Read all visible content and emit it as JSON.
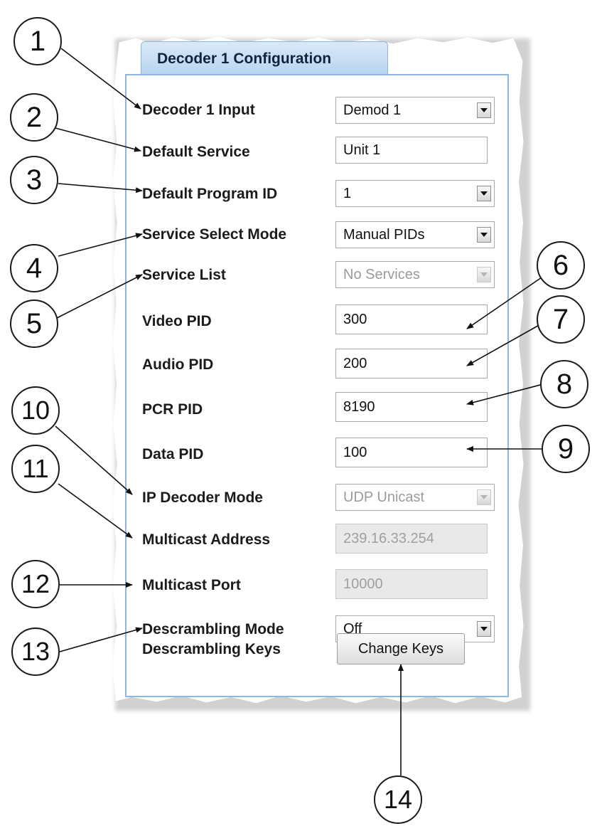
{
  "panel": {
    "tab_title": "Decoder 1 Configuration"
  },
  "rows": {
    "decoder_input": {
      "label": "Decoder 1 Input",
      "value": "Demod 1"
    },
    "default_service": {
      "label": "Default Service",
      "value": "Unit 1"
    },
    "default_program_id": {
      "label": "Default Program ID",
      "value": "1"
    },
    "service_select_mode": {
      "label": "Service Select Mode",
      "value": "Manual PIDs"
    },
    "service_list": {
      "label": "Service List",
      "value": "No Services"
    },
    "video_pid": {
      "label": "Video PID",
      "value": "300"
    },
    "audio_pid": {
      "label": "Audio PID",
      "value": "200"
    },
    "pcr_pid": {
      "label": "PCR PID",
      "value": "8190"
    },
    "data_pid": {
      "label": "Data PID",
      "value": "100"
    },
    "ip_decoder_mode": {
      "label": "IP Decoder Mode",
      "value": "UDP Unicast"
    },
    "multicast_address": {
      "label": "Multicast Address",
      "value": "239.16.33.254"
    },
    "multicast_port": {
      "label": "Multicast Port",
      "value": "10000"
    },
    "descrambling_mode": {
      "label": "Descrambling Mode",
      "value": "Off"
    },
    "descrambling_keys": {
      "label": "Descrambling Keys",
      "button": "Change Keys"
    }
  },
  "callouts": [
    "1",
    "2",
    "3",
    "4",
    "5",
    "6",
    "7",
    "8",
    "9",
    "10",
    "11",
    "12",
    "13",
    "14"
  ]
}
